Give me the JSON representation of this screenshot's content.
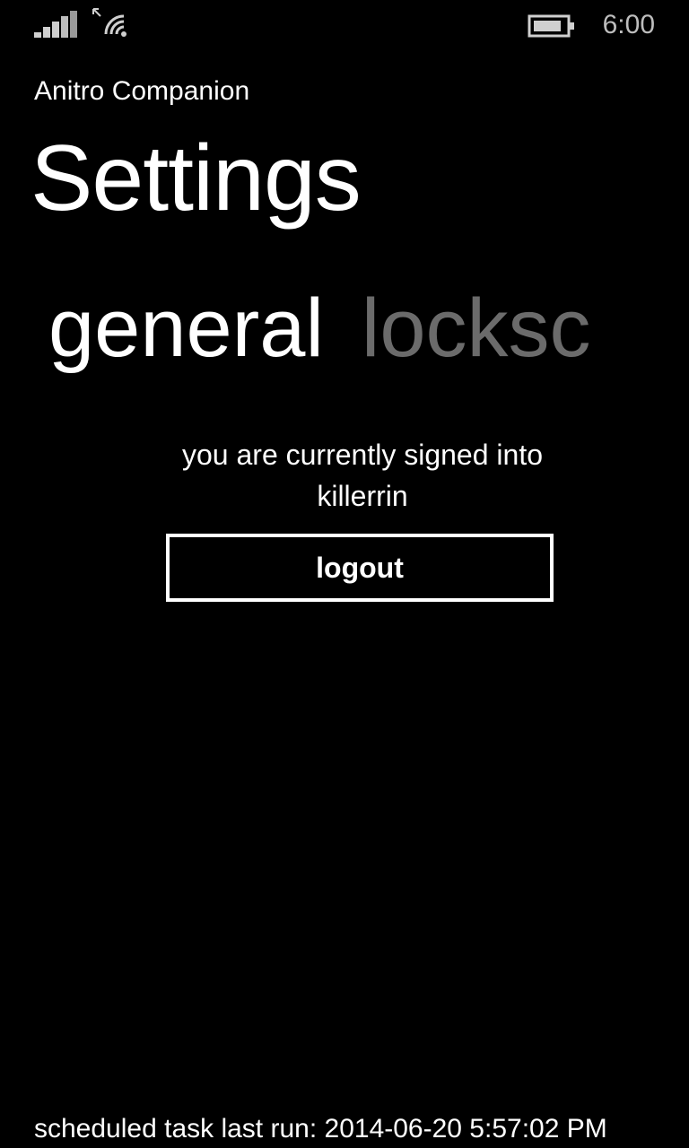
{
  "status_bar": {
    "time": "6:00",
    "signal_icon": "cellular-signal-icon",
    "wifi_icon": "wifi-icon",
    "battery_icon": "battery-icon"
  },
  "app": {
    "name": "Anitro Companion",
    "page_title": "Settings"
  },
  "pivot": {
    "tabs": [
      {
        "label": "general",
        "active": true
      },
      {
        "label": "locksc",
        "active": false
      }
    ]
  },
  "general": {
    "signin_line1": "you are currently signed into",
    "signin_line2": "killerrin",
    "logout_label": "logout"
  },
  "footer": {
    "scheduled_task": "scheduled task last run: 2014-06-20 5:57:02 PM"
  },
  "colors": {
    "background": "#000000",
    "foreground": "#ffffff",
    "inactive_tab": "#6b6b6b",
    "clock": "#bdbdbd"
  }
}
